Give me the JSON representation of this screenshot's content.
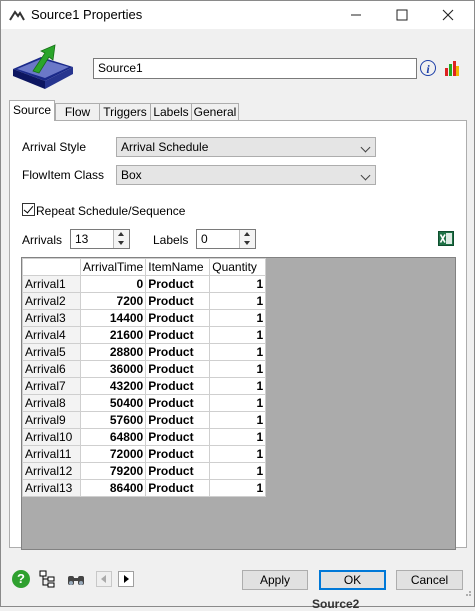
{
  "window": {
    "title": "Source1  Properties",
    "controls": [
      "minimize-icon",
      "maximize-icon",
      "close-icon"
    ]
  },
  "header": {
    "object_name": "Source1",
    "icons": [
      "source-object-icon",
      "info-icon",
      "statistics-icon"
    ]
  },
  "tabs": [
    "Source",
    "Flow",
    "Triggers",
    "Labels",
    "General"
  ],
  "active_tab": "Source",
  "source": {
    "arrival_style_label": "Arrival Style",
    "arrival_style_value": "Arrival Schedule",
    "flowitem_class_label": "FlowItem Class",
    "flowitem_class_value": "Box",
    "repeat_label": "Repeat Schedule/Sequence",
    "repeat_checked": true,
    "arrivals_label": "Arrivals",
    "arrivals_value": "13",
    "labels_label": "Labels",
    "labels_value": "0"
  },
  "table": {
    "columns": [
      "ArrivalTime",
      "ItemName",
      "Quantity"
    ],
    "rows": [
      {
        "header": "Arrival1",
        "time": "0",
        "item": "Product",
        "qty": "1"
      },
      {
        "header": "Arrival2",
        "time": "7200",
        "item": "Product",
        "qty": "1"
      },
      {
        "header": "Arrival3",
        "time": "14400",
        "item": "Product",
        "qty": "1"
      },
      {
        "header": "Arrival4",
        "time": "21600",
        "item": "Product",
        "qty": "1"
      },
      {
        "header": "Arrival5",
        "time": "28800",
        "item": "Product",
        "qty": "1"
      },
      {
        "header": "Arrival6",
        "time": "36000",
        "item": "Product",
        "qty": "1"
      },
      {
        "header": "Arrival7",
        "time": "43200",
        "item": "Product",
        "qty": "1"
      },
      {
        "header": "Arrival8",
        "time": "50400",
        "item": "Product",
        "qty": "1"
      },
      {
        "header": "Arrival9",
        "time": "57600",
        "item": "Product",
        "qty": "1"
      },
      {
        "header": "Arrival10",
        "time": "64800",
        "item": "Product",
        "qty": "1"
      },
      {
        "header": "Arrival11",
        "time": "72000",
        "item": "Product",
        "qty": "1"
      },
      {
        "header": "Arrival12",
        "time": "79200",
        "item": "Product",
        "qty": "1"
      },
      {
        "header": "Arrival13",
        "time": "86400",
        "item": "Product",
        "qty": "1"
      }
    ]
  },
  "footer": {
    "apply": "Apply",
    "ok": "OK",
    "cancel": "Cancel",
    "icons": [
      "help-icon",
      "tree-icon",
      "find-icon",
      "previous-icon",
      "next-icon"
    ]
  },
  "background": {
    "partial_label": "Source2"
  },
  "colors": {
    "accent": "#0078d7",
    "help_green": "#2fa02f",
    "excel_green": "#1e7145"
  }
}
